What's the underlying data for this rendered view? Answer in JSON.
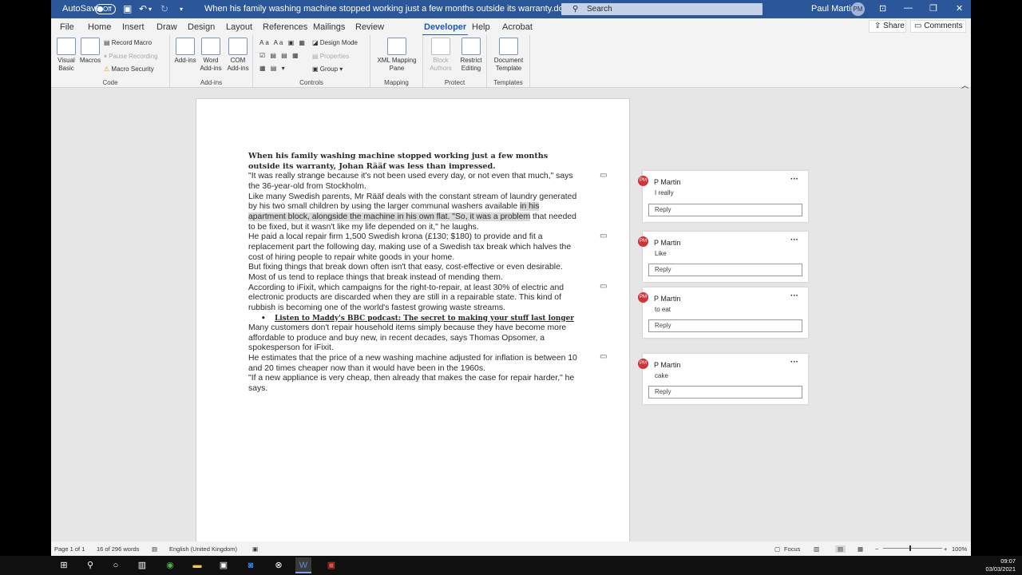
{
  "titlebar": {
    "autosave_label": "AutoSave",
    "autosave_state": "Off",
    "doc_title": "When his family washing machine stopped working just a few months outside its warranty.docx  ·  Saved to this PC",
    "search_placeholder": "Search",
    "user_name": "Paul Martin",
    "user_initials": "PM"
  },
  "tabs": [
    "File",
    "Home",
    "Insert",
    "Draw",
    "Design",
    "Layout",
    "References",
    "Mailings",
    "Review",
    "Developer",
    "Help",
    "Acrobat"
  ],
  "active_tab": "Developer",
  "share_label": "Share",
  "comments_label": "Comments",
  "ribbon": {
    "code": {
      "label": "Code",
      "visual_basic": "Visual Basic",
      "macros": "Macros",
      "record_macro": "Record Macro",
      "pause_recording": "Pause Recording",
      "macro_security": "Macro Security"
    },
    "addins": {
      "label": "Add-ins",
      "addins": "Add-ins",
      "word_addins": "Word Add-ins",
      "com_addins": "COM Add-ins"
    },
    "controls": {
      "label": "Controls",
      "design_mode": "Design Mode",
      "properties": "Properties",
      "group": "Group"
    },
    "mapping": {
      "label": "Mapping",
      "xml_pane": "XML Mapping Pane"
    },
    "protect": {
      "label": "Protect",
      "block_authors": "Block Authors",
      "restrict_editing": "Restrict Editing"
    },
    "templates": {
      "label": "Templates",
      "document_template": "Document Template"
    }
  },
  "document": {
    "heading": "When his family washing machine stopped working just a few months outside its warranty, Johan Rääf was less than impressed.",
    "p1": "\"It was really strange because it's not been used every day, or not even that much,\" says the 36-year-old from Stockholm.",
    "p2a": "Like many Swedish parents, Mr Rääf deals with the constant stream of laundry generated by his two small children by using the larger communal washers available",
    "p2b": "in his apartment block, alongside the machine in his own flat. \"So, it was a problem",
    "p2c": "that needed to be fixed, but it wasn't like my life depended on it,\" he laughs.",
    "p3": "He paid a local repair firm 1,500 Swedish krona (£130; $180) to provide and fit a replacement part the following day, making use of a Swedish tax break which halves the cost of hiring people to repair white goods in your home.",
    "p4": "But fixing things that break down often isn't that easy, cost-effective or even desirable. Most of us tend to replace things that break instead of mending them.",
    "p5": "According to iFixit, which campaigns for the right-to-repair, at least 30% of electric and electronic products are discarded when they are still in a repairable state. This kind of rubbish is becoming one of the world's fastest growing waste streams.",
    "bullet": "Listen to Maddy's BBC podcast: The secret to making your stuff last longer",
    "p6": "Many customers don't repair household items simply because they have become more affordable to produce and buy new, in recent decades, says Thomas Opsomer, a spokesperson for iFixit.",
    "p7": "He estimates that the price of a new washing machine adjusted for inflation is between 10 and 20 times cheaper now than it would have been in the 1960s.",
    "p8": "\"If a new appliance is very cheap, then already that makes the case for repair harder,\" he says."
  },
  "comments": [
    {
      "initials": "PM",
      "author": "P Martin",
      "text": "I really",
      "reply": "Reply"
    },
    {
      "initials": "PM",
      "author": "P Martin",
      "text": "Like",
      "reply": "Reply"
    },
    {
      "initials": "PM",
      "author": "P Martin",
      "text": "to eat",
      "reply": "Reply"
    },
    {
      "initials": "PM",
      "author": "P Martin",
      "text": "cake",
      "reply": "Reply"
    }
  ],
  "status": {
    "page": "Page 1 of 1",
    "words": "16 of 296 words",
    "language": "English (United Kingdom)",
    "focus": "Focus",
    "zoom": "100%"
  },
  "clock": {
    "time": "09:07",
    "date": "03/03/2021"
  }
}
